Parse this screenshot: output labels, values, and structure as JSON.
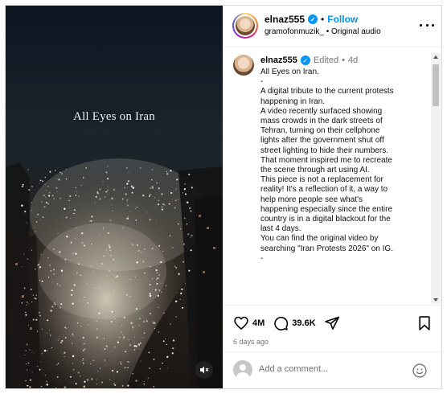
{
  "media": {
    "overlay_text": "All Eyes on Iran",
    "mute_icon": "speaker-muted-icon"
  },
  "header": {
    "username": "elnaz555",
    "separator": "•",
    "follow_label": "Follow",
    "audio_source": "gramofonmuzik_",
    "audio_separator": "•",
    "audio_label": "Original audio"
  },
  "caption": {
    "username": "elnaz555",
    "edited": "Edited",
    "separator": "•",
    "age": "4d",
    "lines": [
      "All Eyes on Iran.",
      "-",
      "A digital tribute to the current protests",
      "happening in Iran.",
      "A video recently surfaced showing",
      "mass crowds in the dark streets of",
      "Tehran, turning on their cellphone",
      "lights after the government shut off",
      "street lighting to hide their numbers.",
      "That moment inspired me to recreate",
      "the scene through art using AI.",
      "This piece is not a replacement for",
      "reality! It's a reflection of it, a way to",
      "help more people see what's",
      "happening especially since the entire",
      "country is in a digital blackout for the",
      "last 4 days.",
      "You can find the original video by",
      "searching \"Iran Protests 2026\" on IG.",
      "-"
    ]
  },
  "actions": {
    "likes": "4M",
    "comments": "39.6K",
    "posted": "6 days ago"
  },
  "comment": {
    "placeholder": "Add a comment..."
  }
}
